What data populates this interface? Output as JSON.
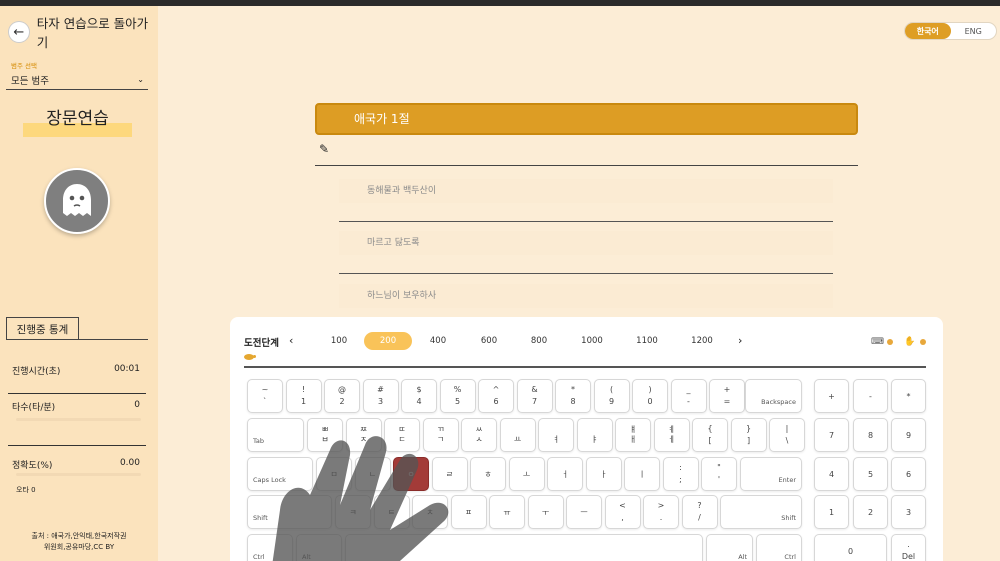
{
  "header": {
    "back_label": "타자 연습으로 돌아가기"
  },
  "language": {
    "korean": "한국어",
    "english": "ENG",
    "active": "korean"
  },
  "sidebar": {
    "category_caption": "범주 선택",
    "category_value": "모든 범주",
    "mode_title": "장문연습",
    "stats_tab": "진행중 통계",
    "stats": {
      "time_label": "진행시간(초)",
      "time_value": "00:01",
      "speed_label": "타수(타/분)",
      "speed_value": "0",
      "accuracy_label": "정확도(%)",
      "accuracy_value": "0.00",
      "typo_label": "오타 0"
    },
    "source_line1": "출처 : 애국가,안익태,한국저작권",
    "source_line2": "위원회,공유마당,CC BY"
  },
  "practice": {
    "title": "애국가 1절",
    "input_value": "",
    "sentences": [
      "동해물과 백두산이",
      "마르고 닳도록",
      "하느님이 보우하사"
    ]
  },
  "levels": {
    "label": "도전단계",
    "options": [
      "100",
      "200",
      "400",
      "600",
      "800",
      "1000",
      "1100",
      "1200"
    ],
    "active": "200"
  },
  "keyboard": {
    "highlighted_key": "ㅇ",
    "rows": [
      [
        {
          "t": "~",
          "b": "`"
        },
        {
          "t": "!",
          "b": "1"
        },
        {
          "t": "@",
          "b": "2"
        },
        {
          "t": "#",
          "b": "3"
        },
        {
          "t": "$",
          "b": "4"
        },
        {
          "t": "%",
          "b": "5"
        },
        {
          "t": "^",
          "b": "6"
        },
        {
          "t": "&",
          "b": "7"
        },
        {
          "t": "*",
          "b": "8"
        },
        {
          "t": "(",
          "b": "9"
        },
        {
          "t": ")",
          "b": "0"
        },
        {
          "t": "_",
          "b": "-"
        },
        {
          "t": "+",
          "b": "="
        }
      ],
      [
        {
          "t": "ㅃ",
          "b": "ㅂ"
        },
        {
          "t": "ㅉ",
          "b": "ㅈ"
        },
        {
          "t": "ㄸ",
          "b": "ㄷ"
        },
        {
          "t": "ㄲ",
          "b": "ㄱ"
        },
        {
          "t": "ㅆ",
          "b": "ㅅ"
        },
        {
          "t": "",
          "b": "ㅛ"
        },
        {
          "t": "",
          "b": "ㅕ"
        },
        {
          "t": "",
          "b": "ㅑ"
        },
        {
          "t": "ㅒ",
          "b": "ㅐ"
        },
        {
          "t": "ㅖ",
          "b": "ㅔ"
        },
        {
          "t": "{",
          "b": "["
        },
        {
          "t": "}",
          "b": "]"
        },
        {
          "t": "|",
          "b": "\\"
        }
      ],
      [
        {
          "c": "ㅁ"
        },
        {
          "c": "ㄴ"
        },
        {
          "c": "ㅇ"
        },
        {
          "c": "ㄹ"
        },
        {
          "c": "ㅎ"
        },
        {
          "c": "ㅗ"
        },
        {
          "c": "ㅓ"
        },
        {
          "c": "ㅏ"
        },
        {
          "c": "ㅣ"
        },
        {
          "t": ":",
          "b": ";"
        },
        {
          "t": "\"",
          "b": "'"
        }
      ],
      [
        {
          "c": "ㅋ"
        },
        {
          "c": "ㅌ"
        },
        {
          "c": "ㅊ"
        },
        {
          "c": "ㅍ"
        },
        {
          "c": "ㅠ"
        },
        {
          "c": "ㅜ"
        },
        {
          "c": "ㅡ"
        },
        {
          "t": "<",
          "b": ","
        },
        {
          "t": ">",
          "b": "."
        },
        {
          "t": "?",
          "b": "/"
        }
      ]
    ],
    "special": {
      "backspace": "Backspace",
      "tab": "Tab",
      "capslock": "Caps Lock",
      "enter": "Enter",
      "shift_left": "Shift",
      "shift_right": "Shift",
      "ctrl_left": "Ctrl",
      "alt_left": "Alt",
      "alt_right": "Alt",
      "ctrl_right": "Ctrl"
    },
    "numpad": [
      "+",
      "-",
      "*",
      "7",
      "8",
      "9",
      "4",
      "5",
      "6",
      "1",
      "2",
      "3",
      "0",
      ".",
      "Del"
    ]
  }
}
